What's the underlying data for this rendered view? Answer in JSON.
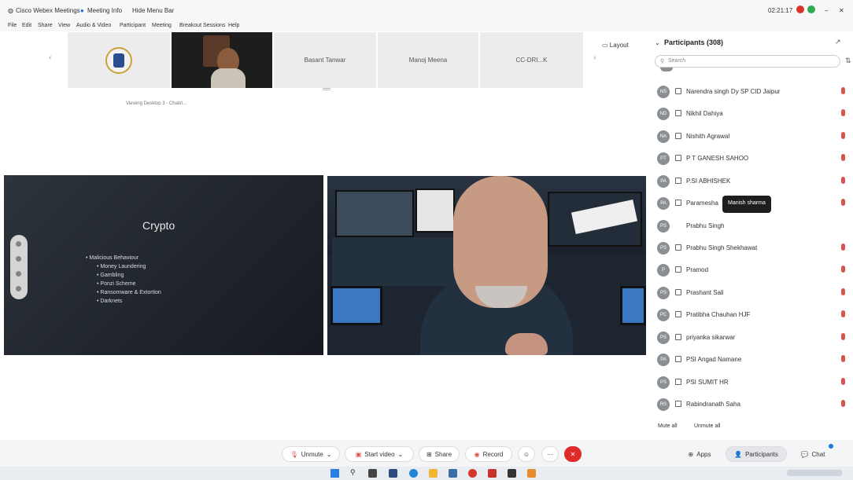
{
  "titlebar": {
    "app": "Cisco Webex Meetings",
    "meeting_info": "Meeting Info",
    "hide_menu_bar": "Hide Menu Bar",
    "time": "02:21:17"
  },
  "menu": [
    "File",
    "Edit",
    "Share",
    "View",
    "Audio & Video",
    "Participant",
    "Meeting",
    "Breakout Sessions",
    "Help"
  ],
  "thumbnails": {
    "names": [
      "Basant Tanwar",
      "Manoj Meena",
      "CC-DRI...K"
    ],
    "layout_label": "Layout",
    "viewing_text": "Viewing Desktop 3 - Chaitri..."
  },
  "shared_slide": {
    "title": "Crypto",
    "bullet": "Malicious Behaviour",
    "sub_bullets": [
      "Money Laundering",
      "Gambling",
      "Ponzi Scheme",
      "Ransomware & Extortion",
      "Darknets"
    ]
  },
  "participants": {
    "header": "Participants (308)",
    "search_placeholder": "Search",
    "list": [
      {
        "name": "Narendra singh Dy SP CID Jaipur",
        "initials": "NS"
      },
      {
        "name": "Nikhil Dahiya",
        "initials": "ND"
      },
      {
        "name": "Nishith Agrawal",
        "initials": "NA"
      },
      {
        "name": "P T GANESH SAHOO",
        "initials": "PT"
      },
      {
        "name": "P.SI ABHISHEK",
        "initials": "PA"
      },
      {
        "name": "Paramesha",
        "initials": "PA"
      },
      {
        "name": "Prabhu Singh",
        "initials": "PS"
      },
      {
        "name": "Prabhu Singh Shekhawat",
        "initials": "PS"
      },
      {
        "name": "Pramod",
        "initials": "P"
      },
      {
        "name": "Prashant Sali",
        "initials": "PS"
      },
      {
        "name": "Pratibha Chauhan HJF",
        "initials": "PC"
      },
      {
        "name": "priyanka sikarwar",
        "initials": "PS"
      },
      {
        "name": "PSI Angad Namane",
        "initials": "PA"
      },
      {
        "name": "PSI SUMIT HR",
        "initials": "PS"
      },
      {
        "name": "Rabindranath Saha",
        "initials": "RS"
      }
    ],
    "tooltip": "Manish sharma",
    "mute_all": "Mute all",
    "unmute_all": "Unmute all"
  },
  "controls": {
    "unmute": "Unmute",
    "start_video": "Start video",
    "share": "Share",
    "record": "Record",
    "apps": "Apps",
    "participants": "Participants",
    "chat": "Chat"
  },
  "colors": {
    "end_red": "#e02b2b",
    "mute_red": "#d9534f",
    "panel_bg": "#ffffff"
  }
}
